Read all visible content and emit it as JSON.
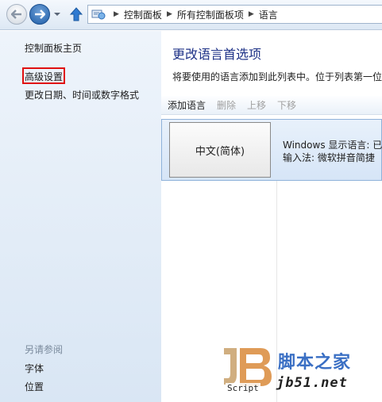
{
  "address_bar": {
    "breadcrumbs": [
      "控制面板",
      "所有控制面板项",
      "语言"
    ]
  },
  "sidebar": {
    "home_link": "控制面板主页",
    "advanced_settings_link": "高级设置",
    "date_time_link": "更改日期、时间或数字格式",
    "see_also_heading": "另请参阅",
    "see_also_items": [
      "字体",
      "位置"
    ]
  },
  "main": {
    "title": "更改语言首选项",
    "description": "将要使用的语言添加到此列表中。位于列表第一位",
    "toolbar": {
      "add": "添加语言",
      "remove": "删除",
      "move_up": "上移",
      "move_down": "下移"
    },
    "languages": [
      {
        "name": "中文(简体)",
        "display_language": "Windows 显示语言: 已启",
        "input_method": "输入法: 微软拼音简捷"
      }
    ]
  },
  "watermark": {
    "script_text": "Script",
    "site_name": "脚本之家",
    "url": "jb51.net"
  },
  "colors": {
    "title": "#1e3287",
    "highlight_box": "#e01010",
    "selected_row": "#d6e5f7",
    "watermark_blue": "#3a6fc4"
  }
}
